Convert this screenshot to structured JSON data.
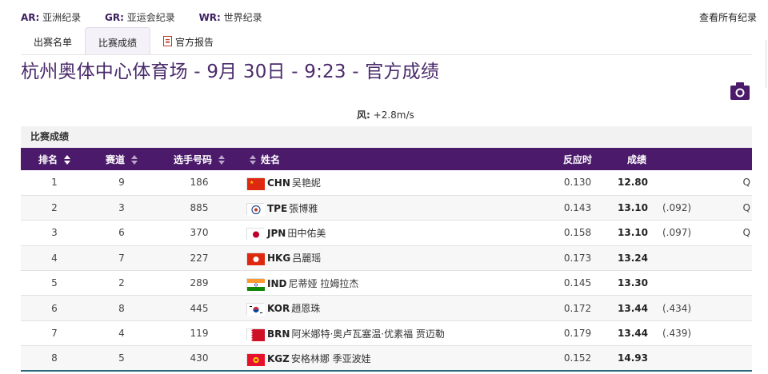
{
  "legend": [
    {
      "code": "AR:",
      "label": "亚洲纪录"
    },
    {
      "code": "GR:",
      "label": "亚运会纪录"
    },
    {
      "code": "WR:",
      "label": "世界纪录"
    }
  ],
  "see_all": "查看所有纪录",
  "tabs": [
    {
      "label": "出赛名单",
      "active": false
    },
    {
      "label": "比赛成绩",
      "active": true
    },
    {
      "label": "官方报告",
      "active": false
    }
  ],
  "title": "杭州奥体中心体育场 - 9月 30日 - 9:23 - 官方成绩",
  "wind": {
    "label": "风:",
    "value": "+2.8m/s"
  },
  "panel_title": "比赛成绩",
  "columns": {
    "rank": "排名",
    "lane": "赛道",
    "bib": "选手号码",
    "name": "姓名",
    "reaction": "反应时",
    "result": "成绩"
  },
  "rows": [
    {
      "rank": "1",
      "lane": "9",
      "bib": "186",
      "country": "CHN",
      "name": "吴艳妮",
      "reaction": "0.130",
      "result": "12.80",
      "diff": "",
      "q": "Q",
      "flag": "chn"
    },
    {
      "rank": "2",
      "lane": "3",
      "bib": "885",
      "country": "TPE",
      "name": "張博雅",
      "reaction": "0.143",
      "result": "13.10",
      "diff": "(.092)",
      "q": "Q",
      "flag": "tpe"
    },
    {
      "rank": "3",
      "lane": "6",
      "bib": "370",
      "country": "JPN",
      "name": "田中佑美",
      "reaction": "0.158",
      "result": "13.10",
      "diff": "(.097)",
      "q": "Q",
      "flag": "jpn"
    },
    {
      "rank": "4",
      "lane": "7",
      "bib": "227",
      "country": "HKG",
      "name": "吕麗瑶",
      "reaction": "0.173",
      "result": "13.24",
      "diff": "",
      "q": "",
      "flag": "hkg"
    },
    {
      "rank": "5",
      "lane": "2",
      "bib": "289",
      "country": "IND",
      "name": "尼蒂娅 拉姆拉杰",
      "reaction": "0.145",
      "result": "13.30",
      "diff": "",
      "q": "",
      "flag": "ind"
    },
    {
      "rank": "6",
      "lane": "8",
      "bib": "445",
      "country": "KOR",
      "name": "趙恩珠",
      "reaction": "0.172",
      "result": "13.44",
      "diff": "(.434)",
      "q": "",
      "flag": "kor"
    },
    {
      "rank": "7",
      "lane": "4",
      "bib": "119",
      "country": "BRN",
      "name": "阿米娜特·奥卢瓦塞温·优素福 贾迈勒",
      "reaction": "0.179",
      "result": "13.44",
      "diff": "(.439)",
      "q": "",
      "flag": "brn"
    },
    {
      "rank": "8",
      "lane": "5",
      "bib": "430",
      "country": "KGZ",
      "name": "安格林娜 季亚波娃",
      "reaction": "0.152",
      "result": "14.93",
      "diff": "",
      "q": "",
      "flag": "kgz"
    }
  ],
  "colors": {
    "header": "#4b1a6b",
    "title": "#4a2a6b",
    "legend_code": "#3b1f5e"
  }
}
